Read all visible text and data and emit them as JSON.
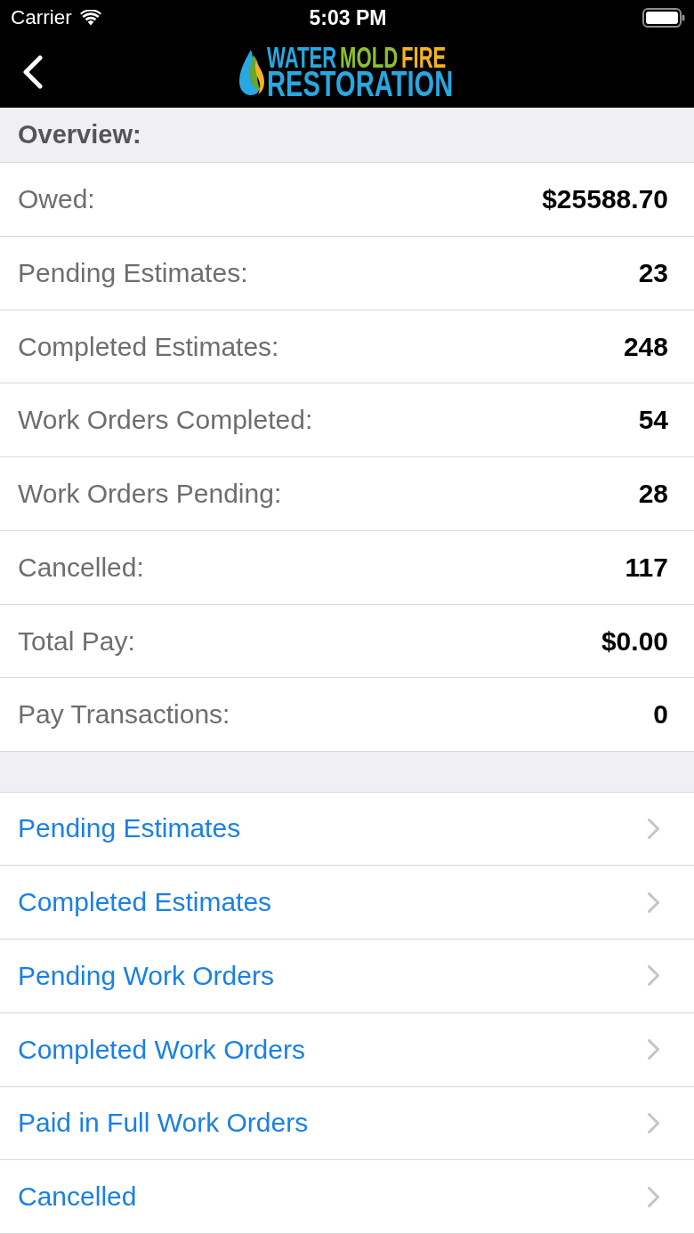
{
  "status_bar": {
    "carrier": "Carrier",
    "time": "5:03 PM"
  },
  "nav_bar": {
    "logo": {
      "line_1": [
        {
          "text": "WATER",
          "color": "#27a8e0"
        },
        {
          "text": "MOLD",
          "color": "#8dbf2a"
        },
        {
          "text": "FIRE",
          "color": "#f4b320"
        }
      ],
      "line_2": "RESTORATION"
    }
  },
  "overview": {
    "title": "Overview:",
    "rows": [
      {
        "label": "Owed:",
        "value": "$25588.70"
      },
      {
        "label": "Pending Estimates:",
        "value": "23"
      },
      {
        "label": "Completed Estimates:",
        "value": "248"
      },
      {
        "label": "Work Orders Completed:",
        "value": "54"
      },
      {
        "label": "Work Orders Pending:",
        "value": "28"
      },
      {
        "label": "Cancelled:",
        "value": "117"
      },
      {
        "label": "Total Pay:",
        "value": "$0.00"
      },
      {
        "label": "Pay Transactions:",
        "value": "0"
      }
    ]
  },
  "links": [
    "Pending Estimates",
    "Completed Estimates",
    "Pending Work Orders",
    "Completed Work Orders",
    "Paid in Full Work Orders",
    "Cancelled"
  ]
}
